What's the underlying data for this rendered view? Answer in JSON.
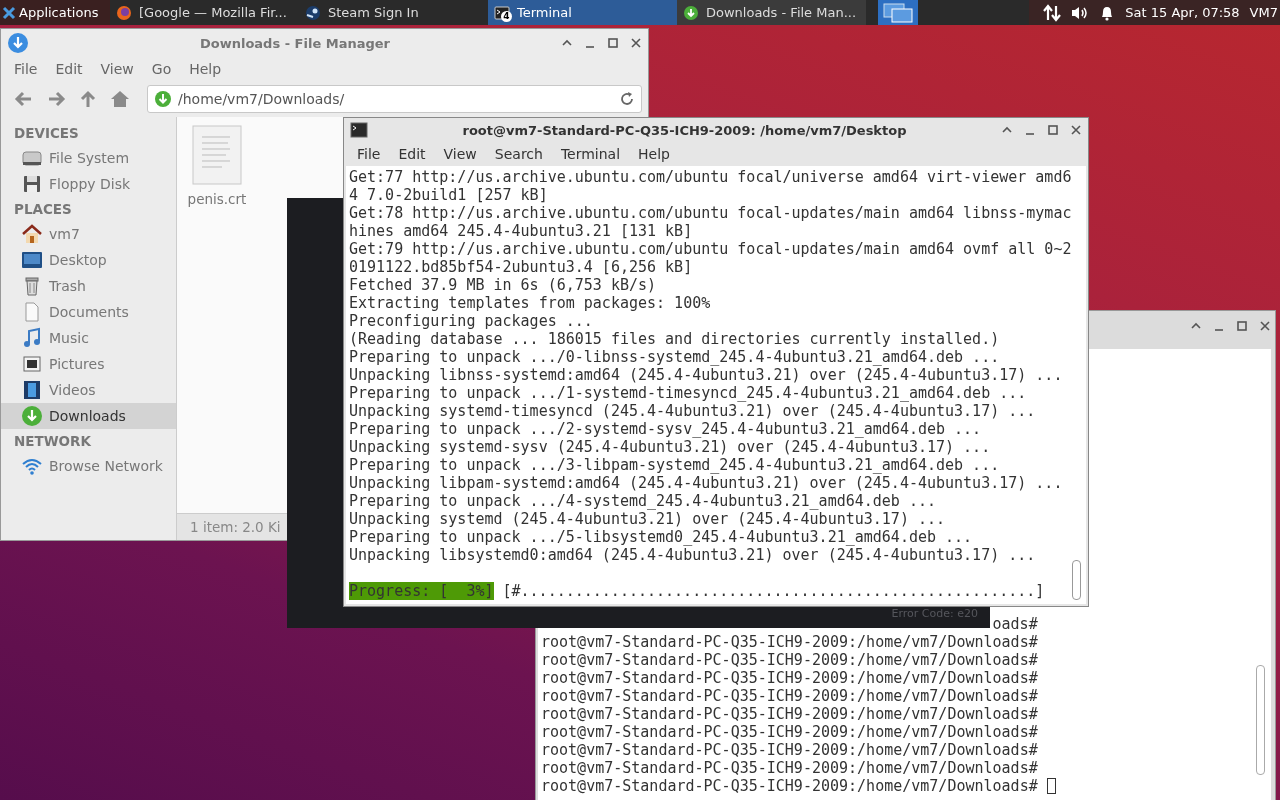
{
  "taskbar": {
    "apps_label": "Applications",
    "tasks": [
      {
        "kind": "firefox",
        "label": "[Google — Mozilla Fir...",
        "selected": false
      },
      {
        "kind": "steam",
        "label": "Steam Sign In",
        "selected": false
      },
      {
        "kind": "terminal",
        "label": "Terminal",
        "badge": "4",
        "selected": true
      },
      {
        "kind": "file-manager",
        "label": "Downloads - File Man...",
        "selected": false
      }
    ],
    "clock": "Sat 15 Apr, 07:58",
    "user": "VM7"
  },
  "file_manager": {
    "title": "Downloads - File Manager",
    "menu": [
      "File",
      "Edit",
      "View",
      "Go",
      "Help"
    ],
    "location": "/home/vm7/Downloads/",
    "sidebar": [
      {
        "heading": "DEVICES",
        "items": [
          {
            "kind": "drive",
            "label": "File System",
            "selected": false
          },
          {
            "kind": "floppy",
            "label": "Floppy Disk",
            "selected": false
          }
        ]
      },
      {
        "heading": "PLACES",
        "items": [
          {
            "kind": "home",
            "label": "vm7",
            "selected": false
          },
          {
            "kind": "desktop",
            "label": "Desktop",
            "selected": false
          },
          {
            "kind": "trash",
            "label": "Trash",
            "selected": false
          },
          {
            "kind": "document",
            "label": "Documents",
            "selected": false
          },
          {
            "kind": "music",
            "label": "Music",
            "selected": false
          },
          {
            "kind": "pictures",
            "label": "Pictures",
            "selected": false
          },
          {
            "kind": "videos",
            "label": "Videos",
            "selected": false
          },
          {
            "kind": "download",
            "label": "Downloads",
            "selected": true
          }
        ]
      },
      {
        "heading": "NETWORK",
        "items": [
          {
            "kind": "network",
            "label": "Browse Network",
            "selected": false
          }
        ]
      }
    ],
    "files": [
      {
        "name": "penis.crt"
      }
    ],
    "status": "1 item: 2.0 Ki"
  },
  "error_window": {
    "text": "Error Code: e20"
  },
  "terminal": {
    "title": "root@vm7-Standard-PC-Q35-ICH9-2009: /home/vm7/Desktop",
    "menu": [
      "File",
      "Edit",
      "View",
      "Search",
      "Terminal",
      "Help"
    ],
    "lines": [
      "Get:77 http://us.archive.ubuntu.com/ubuntu focal/universe amd64 virt-viewer amd6",
      "4 7.0-2build1 [257 kB]",
      "Get:78 http://us.archive.ubuntu.com/ubuntu focal-updates/main amd64 libnss-mymac",
      "hines amd64 245.4-4ubuntu3.21 [131 kB]",
      "Get:79 http://us.archive.ubuntu.com/ubuntu focal-updates/main amd64 ovmf all 0~2",
      "0191122.bd85bf54-2ubuntu3.4 [6,256 kB]",
      "Fetched 37.9 MB in 6s (6,753 kB/s)",
      "Extracting templates from packages: 100%",
      "Preconfiguring packages ...",
      "(Reading database ... 186015 files and directories currently installed.)",
      "Preparing to unpack .../0-libnss-systemd_245.4-4ubuntu3.21_amd64.deb ...",
      "Unpacking libnss-systemd:amd64 (245.4-4ubuntu3.21) over (245.4-4ubuntu3.17) ...",
      "Preparing to unpack .../1-systemd-timesyncd_245.4-4ubuntu3.21_amd64.deb ...",
      "Unpacking systemd-timesyncd (245.4-4ubuntu3.21) over (245.4-4ubuntu3.17) ...",
      "Preparing to unpack .../2-systemd-sysv_245.4-4ubuntu3.21_amd64.deb ...",
      "Unpacking systemd-sysv (245.4-4ubuntu3.21) over (245.4-4ubuntu3.17) ...",
      "Preparing to unpack .../3-libpam-systemd_245.4-4ubuntu3.21_amd64.deb ...",
      "Unpacking libpam-systemd:amd64 (245.4-4ubuntu3.21) over (245.4-4ubuntu3.17) ...",
      "Preparing to unpack .../4-systemd_245.4-4ubuntu3.21_amd64.deb ...",
      "Unpacking systemd (245.4-4ubuntu3.21) over (245.4-4ubuntu3.17) ...",
      "Preparing to unpack .../5-libsystemd0_245.4-4ubuntu3.21_amd64.deb ...",
      "Unpacking libsystemd0:amd64 (245.4-4ubuntu3.21) over (245.4-4ubuntu3.17) ..."
    ],
    "progress": {
      "label": "Progress: [  3%]",
      "bar": "[#.........................................................]"
    }
  },
  "back_terminal": {
    "lines": [
      "oads#",
      "root@vm7-Standard-PC-Q35-ICH9-2009:/home/vm7/Downloads#",
      "root@vm7-Standard-PC-Q35-ICH9-2009:/home/vm7/Downloads#",
      "root@vm7-Standard-PC-Q35-ICH9-2009:/home/vm7/Downloads#",
      "root@vm7-Standard-PC-Q35-ICH9-2009:/home/vm7/Downloads#",
      "root@vm7-Standard-PC-Q35-ICH9-2009:/home/vm7/Downloads#",
      "root@vm7-Standard-PC-Q35-ICH9-2009:/home/vm7/Downloads#",
      "root@vm7-Standard-PC-Q35-ICH9-2009:/home/vm7/Downloads#",
      "root@vm7-Standard-PC-Q35-ICH9-2009:/home/vm7/Downloads#",
      "root@vm7-Standard-PC-Q35-ICH9-2009:/home/vm7/Downloads#"
    ]
  }
}
